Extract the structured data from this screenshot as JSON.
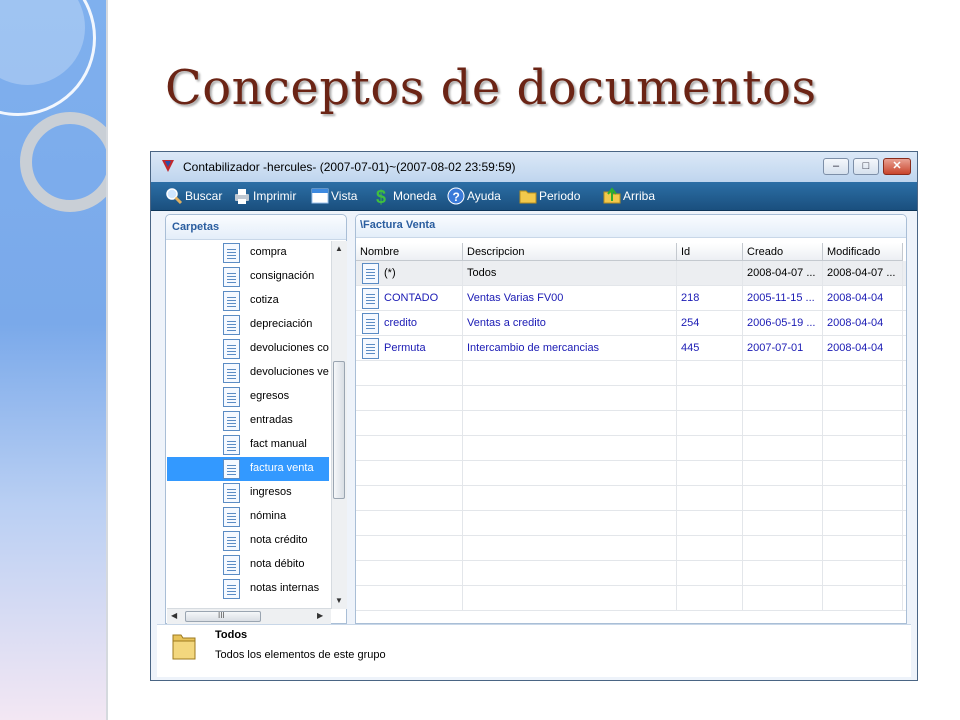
{
  "slide": {
    "title": "Conceptos de documentos"
  },
  "window": {
    "title": "Contabilizador -hercules- (2007-07-01)~(2007-08-02 23:59:59)",
    "controls": {
      "minimize": "–",
      "maximize": "□",
      "close": "✕"
    }
  },
  "toolbar": {
    "items": [
      {
        "label": "Buscar",
        "icon": "search-icon"
      },
      {
        "label": "Imprimir",
        "icon": "printer-icon"
      },
      {
        "label": "Vista",
        "icon": "window-view-icon"
      },
      {
        "label": "Moneda",
        "icon": "dollar-icon"
      },
      {
        "label": "Ayuda",
        "icon": "help-icon"
      },
      {
        "label": "Periodo",
        "icon": "folder-icon"
      },
      {
        "label": "Arriba",
        "icon": "folder-up-icon"
      }
    ]
  },
  "folders": {
    "header": "Carpetas",
    "items": [
      {
        "label": "compra"
      },
      {
        "label": "consignación"
      },
      {
        "label": "cotiza"
      },
      {
        "label": "depreciación"
      },
      {
        "label": "devoluciones co"
      },
      {
        "label": "devoluciones ve"
      },
      {
        "label": "egresos"
      },
      {
        "label": "entradas"
      },
      {
        "label": "fact manual"
      },
      {
        "label": "factura venta",
        "selected": true
      },
      {
        "label": "ingresos"
      },
      {
        "label": "nómina"
      },
      {
        "label": "nota crédito"
      },
      {
        "label": "nota débito"
      },
      {
        "label": "notas internas"
      }
    ],
    "hscroll_mark": "III"
  },
  "content": {
    "path": "\\Factura Venta",
    "columns": [
      "Nombre",
      "Descripcion",
      "Id",
      "Creado",
      "Modificado"
    ],
    "rows": [
      {
        "nombre": "(*)",
        "descripcion": "Todos",
        "id": "",
        "creado": "2008-04-07 ...",
        "modificado": "2008-04-07 ..."
      },
      {
        "nombre": "CONTADO",
        "descripcion": "Ventas Varias FV00",
        "id": "218",
        "creado": "2005-11-15 ...",
        "modificado": "2008-04-04"
      },
      {
        "nombre": "credito",
        "descripcion": "Ventas a credito",
        "id": "254",
        "creado": "2006-05-19 ...",
        "modificado": "2008-04-04"
      },
      {
        "nombre": "Permuta",
        "descripcion": "Intercambio de mercancias",
        "id": "445",
        "creado": "2007-07-01",
        "modificado": "2008-04-04"
      }
    ]
  },
  "status": {
    "title": "Todos",
    "description": "Todos los elementos de este grupo"
  },
  "colors": {
    "title": "#6b2415",
    "link": "#1a1ab4",
    "toolbar": "#1f5a8d",
    "selection": "#3399ff"
  }
}
